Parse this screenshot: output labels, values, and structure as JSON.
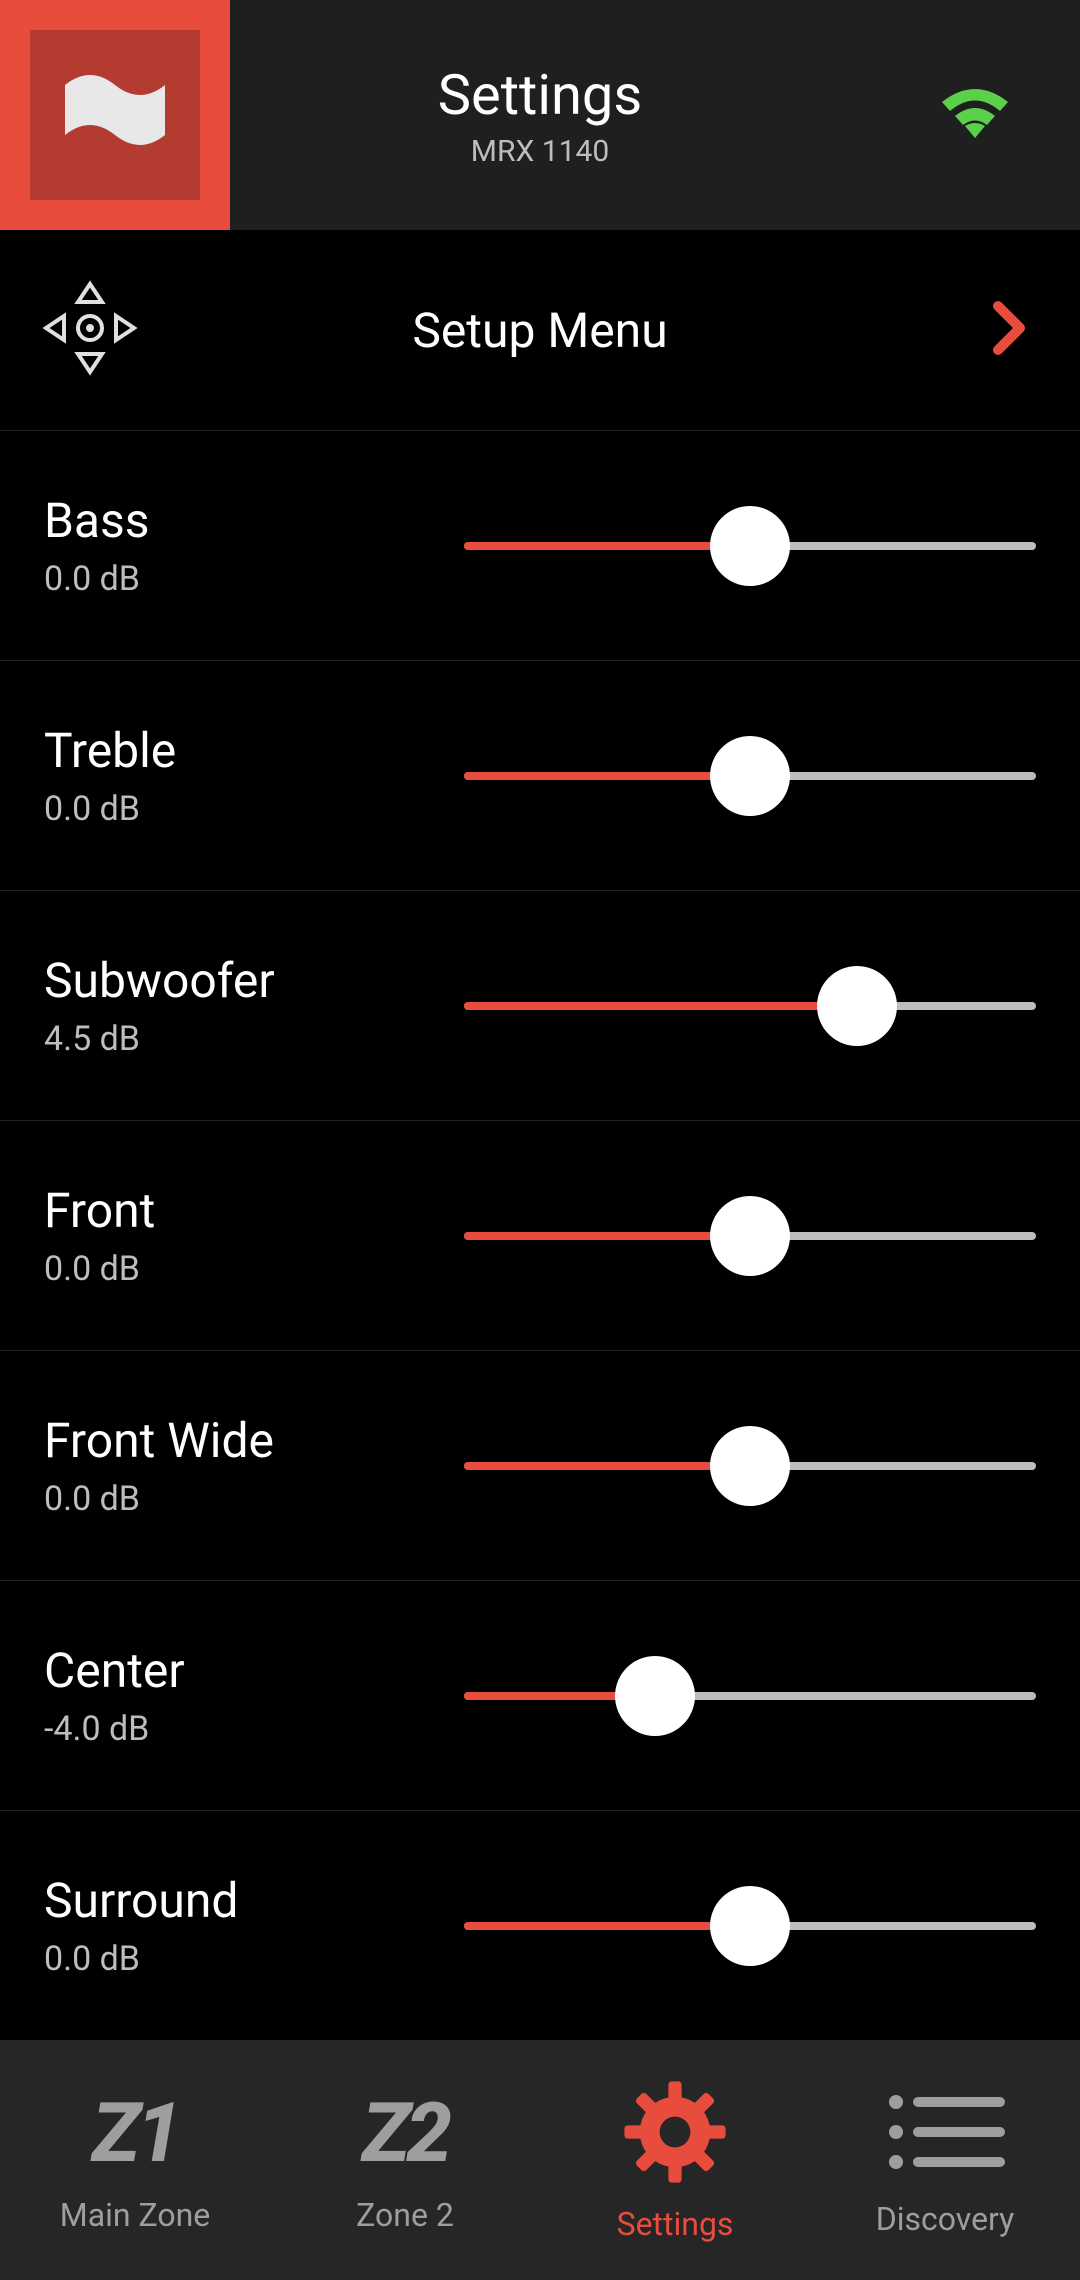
{
  "header": {
    "title": "Settings",
    "subtitle": "MRX 1140"
  },
  "setup_menu": {
    "label": "Setup Menu"
  },
  "slider_range": {
    "min": -12,
    "max": 12
  },
  "sliders": [
    {
      "name": "Bass",
      "value_label": "0.0 dB",
      "value": 0.0
    },
    {
      "name": "Treble",
      "value_label": "0.0 dB",
      "value": 0.0
    },
    {
      "name": "Subwoofer",
      "value_label": "4.5 dB",
      "value": 4.5
    },
    {
      "name": "Front",
      "value_label": "0.0 dB",
      "value": 0.0
    },
    {
      "name": "Front Wide",
      "value_label": "0.0 dB",
      "value": 0.0
    },
    {
      "name": "Center",
      "value_label": "-4.0 dB",
      "value": -4.0
    },
    {
      "name": "Surround",
      "value_label": "0.0 dB",
      "value": 0.0
    }
  ],
  "bottom_nav": {
    "items": [
      {
        "icon_text": "Z1",
        "label": "Main Zone",
        "active": false
      },
      {
        "icon_text": "Z2",
        "label": "Zone 2",
        "active": false
      },
      {
        "icon_text": "",
        "label": "Settings",
        "active": true
      },
      {
        "icon_text": "",
        "label": "Discovery",
        "active": false
      }
    ]
  },
  "colors": {
    "accent": "#e84c3d",
    "wifi": "#4caf50"
  }
}
